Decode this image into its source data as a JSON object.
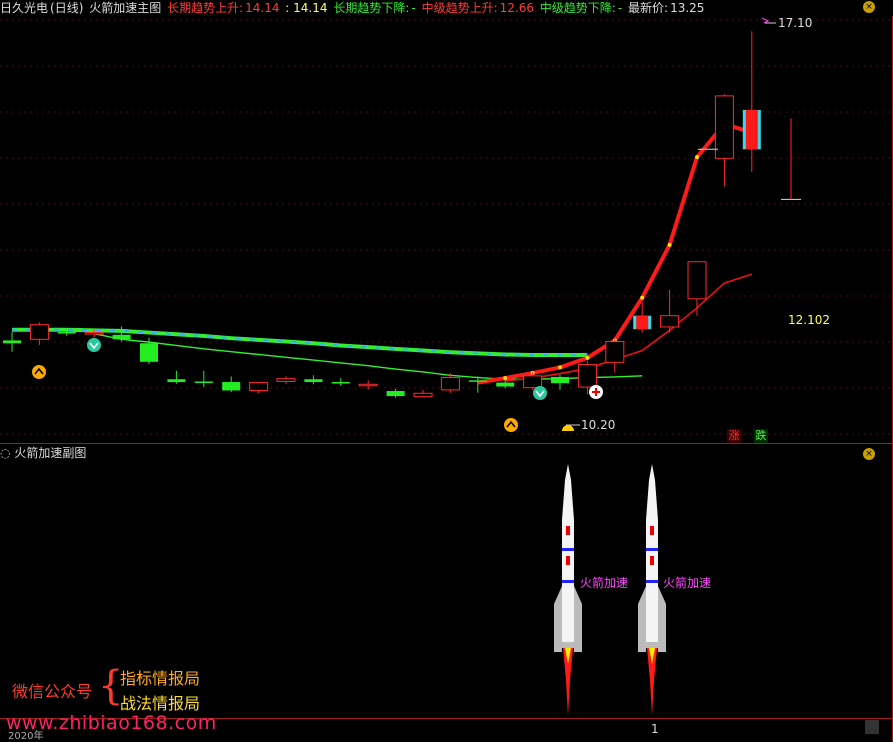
{
  "header": {
    "stock": "日久光电",
    "period": "(日线)",
    "indicator": "火箭加速主图",
    "long_up_label": "长期趋势上升:",
    "long_up_value": "14.14",
    "long_up_value2": ": 14.14",
    "long_down_label": "长期趋势下降:",
    "long_down_value": "-",
    "mid_up_label": "中级趋势上升:",
    "mid_up_value": "12.66",
    "mid_down_label": "中级趋势下降:",
    "mid_down_value": "-",
    "last_label": "最新价:",
    "last_value": "13.25"
  },
  "sub_header": {
    "indicator": "火箭加速副图"
  },
  "toggles": {
    "rise": "涨",
    "fall": "跌"
  },
  "price_labels": {
    "high": "17.10",
    "low": "10.20",
    "line": "12.102"
  },
  "rocket_label": "火箭加速",
  "watermark": {
    "wechat": "微信公众号",
    "line1": "指标情报局",
    "line2": "战法情报局",
    "site": "www.zhibiao168.com"
  },
  "footer": {
    "date": "2020年",
    "cursor": "1"
  },
  "colors": {
    "up": "#ff2a2a",
    "down": "#22ee22",
    "cyan": "#3ad8e8",
    "ma_long": "#33ee33",
    "ma_mid": "#ff1a1a"
  },
  "chart_data": {
    "type": "candlestick",
    "y_range": [
      9.9,
      17.3
    ],
    "candles": [
      {
        "o": 11.6,
        "h": 11.75,
        "l": 11.4,
        "c": 11.55,
        "col": "down"
      },
      {
        "o": 11.62,
        "h": 11.92,
        "l": 11.52,
        "c": 11.88,
        "col": "up"
      },
      {
        "o": 11.75,
        "h": 11.82,
        "l": 11.68,
        "c": 11.73,
        "col": "down"
      },
      {
        "o": 11.73,
        "h": 11.8,
        "l": 11.65,
        "c": 11.74,
        "col": "up"
      },
      {
        "o": 11.7,
        "h": 11.85,
        "l": 11.58,
        "c": 11.62,
        "col": "down"
      },
      {
        "o": 11.55,
        "h": 11.65,
        "l": 11.18,
        "c": 11.22,
        "col": "down"
      },
      {
        "o": 10.91,
        "h": 11.06,
        "l": 10.83,
        "c": 10.86,
        "col": "down"
      },
      {
        "o": 10.87,
        "h": 11.06,
        "l": 10.77,
        "c": 10.87,
        "col": "down"
      },
      {
        "o": 10.86,
        "h": 10.96,
        "l": 10.68,
        "c": 10.71,
        "col": "down"
      },
      {
        "o": 10.71,
        "h": 10.86,
        "l": 10.66,
        "c": 10.85,
        "col": "up"
      },
      {
        "o": 10.87,
        "h": 10.96,
        "l": 10.82,
        "c": 10.92,
        "col": "up"
      },
      {
        "o": 10.91,
        "h": 10.98,
        "l": 10.82,
        "c": 10.86,
        "col": "down"
      },
      {
        "o": 10.86,
        "h": 10.93,
        "l": 10.79,
        "c": 10.84,
        "col": "down"
      },
      {
        "o": 10.82,
        "h": 10.89,
        "l": 10.73,
        "c": 10.81,
        "col": "up"
      },
      {
        "o": 10.7,
        "h": 10.74,
        "l": 10.58,
        "c": 10.61,
        "col": "down"
      },
      {
        "o": 10.6,
        "h": 10.72,
        "l": 10.59,
        "c": 10.66,
        "col": "up"
      },
      {
        "o": 10.72,
        "h": 11.02,
        "l": 10.67,
        "c": 10.94,
        "col": "up"
      },
      {
        "o": 10.89,
        "h": 10.96,
        "l": 10.67,
        "c": 10.87,
        "col": "down"
      },
      {
        "o": 10.85,
        "h": 10.91,
        "l": 10.75,
        "c": 10.78,
        "col": "down"
      },
      {
        "o": 10.76,
        "h": 11.04,
        "l": 10.72,
        "c": 10.97,
        "col": "up"
      },
      {
        "o": 10.95,
        "h": 10.99,
        "l": 10.72,
        "c": 10.84,
        "col": "down"
      },
      {
        "o": 10.77,
        "h": 11.24,
        "l": 10.64,
        "c": 11.17,
        "col": "up"
      },
      {
        "o": 11.21,
        "h": 11.66,
        "l": 11.03,
        "c": 11.58,
        "col": "up"
      },
      {
        "o": 12.04,
        "h": 12.28,
        "l": 11.74,
        "c": 11.8,
        "col": "cyan"
      },
      {
        "o": 11.84,
        "h": 12.5,
        "l": 11.74,
        "c": 12.04,
        "col": "up"
      },
      {
        "o": 12.34,
        "h": 13.0,
        "l": 12.04,
        "c": 13.0,
        "col": "up"
      },
      {
        "o": 14.84,
        "h": 15.98,
        "l": 14.34,
        "c": 15.95,
        "col": "up"
      },
      {
        "o": 15.0,
        "h": 17.1,
        "l": 14.6,
        "c": 15.7,
        "col": "cyan"
      }
    ],
    "marks": [
      {
        "x": 708,
        "price": 15.0
      },
      {
        "x": 791,
        "price": 14.11
      }
    ],
    "ma_long": [
      11.79,
      11.79,
      11.79,
      11.78,
      11.77,
      11.74,
      11.71,
      11.68,
      11.64,
      11.61,
      11.58,
      11.55,
      11.51,
      11.48,
      11.45,
      11.42,
      11.39,
      11.37,
      11.35,
      11.34,
      11.34,
      11.34
    ],
    "ma_long_green": [
      11.72,
      11.62,
      11.57,
      11.51,
      11.45,
      11.4,
      11.35,
      11.3,
      11.25,
      11.2,
      11.15,
      11.09,
      11.04,
      10.98,
      10.94,
      10.91,
      10.91,
      10.92,
      10.94,
      10.95,
      10.97
    ],
    "ma_mid": [
      10.85,
      10.93,
      11.02,
      11.12,
      11.29,
      11.6,
      12.36,
      13.3,
      14.86,
      15.45,
      15.3
    ],
    "ma_mid2": [
      10.88,
      10.93,
      11.01,
      11.1,
      11.26,
      11.42,
      11.78,
      12.18,
      12.62,
      12.78
    ]
  }
}
